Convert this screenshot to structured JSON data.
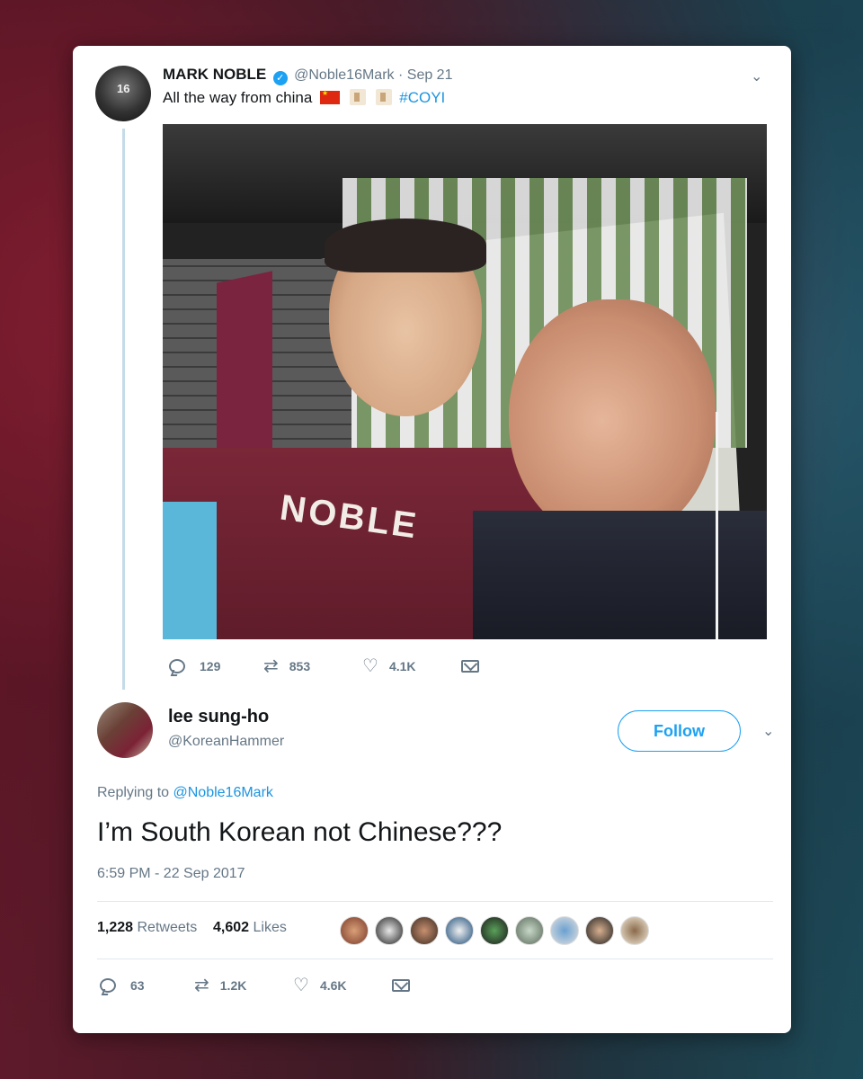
{
  "original_tweet": {
    "name": "MARK NOBLE",
    "handle": "@Noble16Mark",
    "date": "Sep 21",
    "text": "All the way from china",
    "hashtag": "#COYI",
    "shirt_text": "NOBLE",
    "avatar_text": "16",
    "replies": "129",
    "retweets": "853",
    "likes": "4.1K"
  },
  "reply_tweet": {
    "name": "lee sung-ho",
    "handle": "@KoreanHammer",
    "follow_label": "Follow",
    "replying_prefix": "Replying to",
    "replying_mention": "@Noble16Mark",
    "text": "I’m South Korean not Chinese???",
    "timestamp": "6:59 PM - 22 Sep 2017",
    "retweet_count": "1,228",
    "retweet_label": "Retweets",
    "like_count": "4,602",
    "like_label": "Likes",
    "replies": "63",
    "retweets_short": "1.2K",
    "likes_short": "4.6K"
  },
  "icons": [
    "reply-icon",
    "retweet-icon",
    "heart-icon",
    "mail-icon",
    "chevron-down-icon",
    "verified-icon"
  ],
  "colors": {
    "accent": "#1da1f2",
    "link": "#1b95e0",
    "muted": "#657786",
    "text": "#14171a"
  }
}
